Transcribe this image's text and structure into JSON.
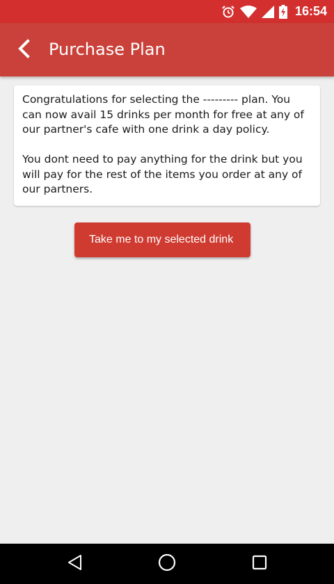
{
  "status_bar": {
    "time": "16:54",
    "icons": [
      "alarm-icon",
      "wifi-icon",
      "signal-icon",
      "battery-charging-icon"
    ]
  },
  "app_bar": {
    "back_icon": "chevron-left-icon",
    "title": "Purchase Plan"
  },
  "card": {
    "paragraph_1": "Congratulations for selecting the --------- plan. You can now avail 15 drinks per month for free at any of our partner's cafe with one drink a day policy.",
    "paragraph_2": "You dont need to pay anything for the drink but you will pay for the rest of the items you order at any of our partners."
  },
  "action": {
    "label": "Take me to my selected drink"
  },
  "nav_bar": {
    "icons": [
      "back-triangle-icon",
      "home-circle-icon",
      "recents-square-icon"
    ]
  },
  "colors": {
    "status_bar": "#d32f2f",
    "app_bar": "#c9413a",
    "button": "#cf3b31",
    "background": "#efefef"
  }
}
